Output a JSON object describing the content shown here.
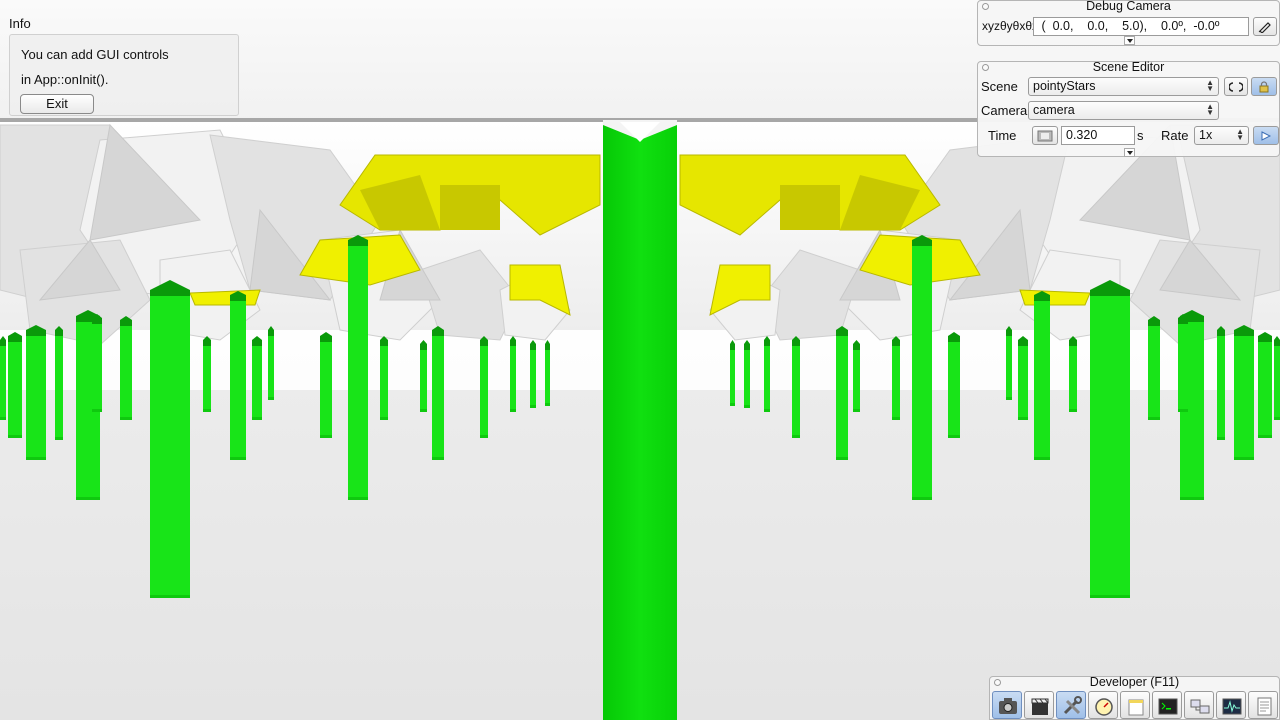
{
  "info": {
    "title": "Info",
    "line1": "You can add GUI controls",
    "line2": "in App::onInit().",
    "exit_label": "Exit"
  },
  "debug_camera": {
    "title": "Debug Camera",
    "label": "xyzθyθxθz",
    "value": " (  0.0,    0.0,    5.0),    0.0º,  -0.0º"
  },
  "scene_editor": {
    "title": "Scene Editor",
    "scene_label": "Scene",
    "scene_value": "pointyStars",
    "camera_label": "Camera",
    "camera_value": "camera",
    "time_label": "Time",
    "time_value": "0.320",
    "time_unit": "s",
    "rate_label": "Rate",
    "rate_value": "1x"
  },
  "developer": {
    "title": "Developer (F11)",
    "buttons": [
      {
        "icon": "camera-icon"
      },
      {
        "icon": "clapperboard-icon"
      },
      {
        "icon": "tools-icon"
      },
      {
        "icon": "speedometer-icon"
      },
      {
        "icon": "window-icon"
      },
      {
        "icon": "terminal-icon"
      },
      {
        "icon": "network-icon"
      },
      {
        "icon": "profiler-icon"
      },
      {
        "icon": "document-icon"
      }
    ]
  },
  "colors": {
    "pillar_green": "#18e418",
    "pillar_dark_green": "#0a9a0a",
    "star_yellow": "#e6e600",
    "star_white": "#ececec",
    "floor": "#e8e8e8",
    "accent_blue": "#9fbfe8"
  }
}
